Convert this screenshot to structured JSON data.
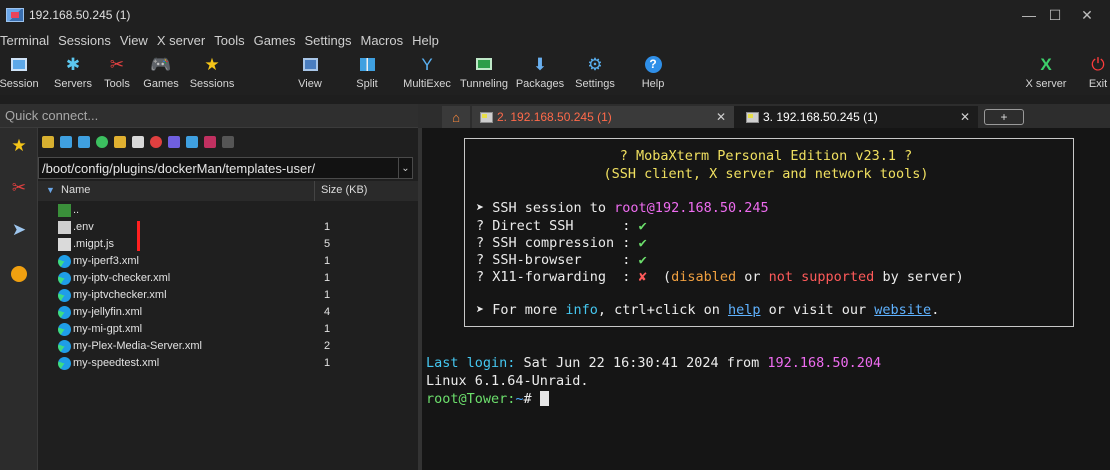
{
  "window": {
    "title": "192.168.50.245 (1)"
  },
  "menu": [
    "Terminal",
    "Sessions",
    "View",
    "X server",
    "Tools",
    "Games",
    "Settings",
    "Macros",
    "Help"
  ],
  "toolbar": {
    "session": "Session",
    "servers": "Servers",
    "tools": "Tools",
    "games": "Games",
    "sessions": "Sessions",
    "view": "View",
    "split": "Split",
    "multiexec": "MultiExec",
    "tunneling": "Tunneling",
    "packages": "Packages",
    "settings": "Settings",
    "help": "Help",
    "xserver": "X server",
    "exit": "Exit"
  },
  "quick_connect": {
    "placeholder": "Quick connect..."
  },
  "tabs": [
    {
      "label": "2. 192.168.50.245 (1)",
      "color": "#ff6a4a"
    },
    {
      "label": "3. 192.168.50.245 (1)",
      "color": "#ffffff"
    }
  ],
  "tab_add": "+",
  "browser": {
    "path": "/boot/config/plugins/dockerMan/templates-user/",
    "col_name": "Name",
    "col_size": "Size (KB)",
    "files": [
      {
        "name": "..",
        "size": "",
        "icon": "up-folder-icon"
      },
      {
        "name": ".env",
        "size": "1",
        "icon": "file-icon"
      },
      {
        "name": ".migpt.js",
        "size": "5",
        "icon": "js-file-icon"
      },
      {
        "name": "my-iperf3.xml",
        "size": "1",
        "icon": "edge-icon"
      },
      {
        "name": "my-iptv-checker.xml",
        "size": "1",
        "icon": "edge-icon"
      },
      {
        "name": "my-iptvchecker.xml",
        "size": "1",
        "icon": "edge-icon"
      },
      {
        "name": "my-jellyfin.xml",
        "size": "4",
        "icon": "edge-icon"
      },
      {
        "name": "my-mi-gpt.xml",
        "size": "1",
        "icon": "edge-icon"
      },
      {
        "name": "my-Plex-Media-Server.xml",
        "size": "2",
        "icon": "edge-icon"
      },
      {
        "name": "my-speedtest.xml",
        "size": "1",
        "icon": "edge-icon"
      }
    ]
  },
  "terminal": {
    "banner_title": "? MobaXterm Personal Edition v23.1 ?",
    "banner_sub": "(SSH client, X server and network tools)",
    "ssh_prefix": "➤ SSH session to ",
    "ssh_target": "root@192.168.50.245",
    "items": [
      {
        "label": "? Direct SSH      : ",
        "mark": "✔"
      },
      {
        "label": "? SSH compression : ",
        "mark": "✔"
      },
      {
        "label": "? SSH-browser     : ",
        "mark": "✔"
      }
    ],
    "x11_label": "? X11-forwarding  : ",
    "x11_mark": "✘",
    "x11_open": "  (",
    "x11_disabled": "disabled",
    "x11_or": " or ",
    "x11_notsupp": "not supported",
    "x11_close": " by server)",
    "more_prefix": "➤ For more ",
    "more_info": "info",
    "more_mid": ", ctrl+click on ",
    "more_help": "help",
    "more_mid2": " or visit our ",
    "more_site": "website",
    "more_end": ".",
    "last_login_label": "Last login:",
    "last_login_text": " Sat Jun 22 16:30:41 2024 from ",
    "last_login_ip": "192.168.50.204",
    "linux": "Linux 6.1.64-Unraid.",
    "prompt_user": "root@Tower:",
    "prompt_path": "~",
    "prompt_sym": "# "
  }
}
